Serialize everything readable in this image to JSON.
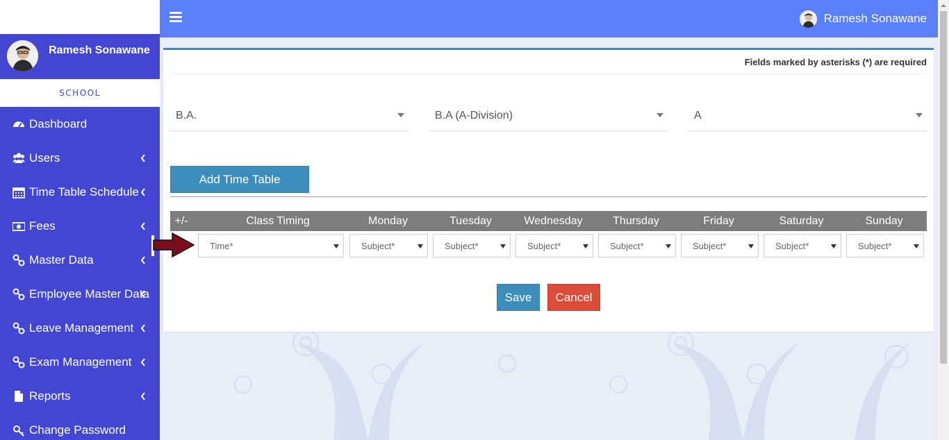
{
  "user": {
    "name": "Ramesh Sonawane"
  },
  "sidebar": {
    "section": "SCHOOL",
    "items": [
      {
        "label": "Dashboard",
        "icon": "dashboard-icon",
        "has_submenu": false
      },
      {
        "label": "Users",
        "icon": "users-icon",
        "has_submenu": true
      },
      {
        "label": "Time Table Schedule",
        "icon": "calendar-icon",
        "has_submenu": true
      },
      {
        "label": "Fees",
        "icon": "money-icon",
        "has_submenu": true
      },
      {
        "label": "Master Data",
        "icon": "link-icon",
        "has_submenu": true
      },
      {
        "label": "Employee Master Data",
        "icon": "link-icon",
        "has_submenu": true
      },
      {
        "label": "Leave Management",
        "icon": "link-icon",
        "has_submenu": true
      },
      {
        "label": "Exam Management",
        "icon": "link-icon",
        "has_submenu": true
      },
      {
        "label": "Reports",
        "icon": "file-icon",
        "has_submenu": true
      },
      {
        "label": "Change Password",
        "icon": "key-icon",
        "has_submenu": false
      }
    ]
  },
  "form": {
    "required_note": "Fields marked by asterisks (*) are required",
    "course": "B.A.",
    "division": "B.A (A-Division)",
    "section": "A",
    "add_button": "Add Time Table",
    "table": {
      "headers": [
        "+/-",
        "Class Timing",
        "Monday",
        "Tuesday",
        "Wednesday",
        "Thursday",
        "Friday",
        "Saturday",
        "Sunday"
      ],
      "row": {
        "time_placeholder": "Time*",
        "subject_placeholder": "Subject*"
      }
    },
    "save_button": "Save",
    "cancel_button": "Cancel"
  },
  "colors": {
    "sidebar": "#4346d2",
    "header": "#5b7ff8",
    "primary": "#3c8dbc",
    "danger": "#dd4b39",
    "arrow": "#7a0e1a"
  }
}
